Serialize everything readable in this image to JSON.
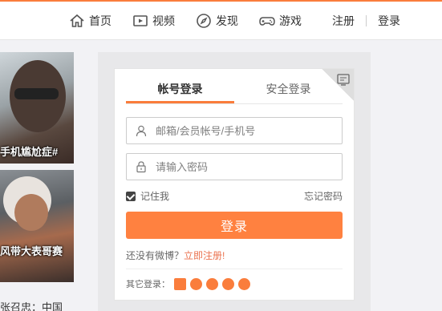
{
  "nav": {
    "items": [
      {
        "label": "首页",
        "icon": "home-icon"
      },
      {
        "label": "视频",
        "icon": "video-icon"
      },
      {
        "label": "发现",
        "icon": "compass-icon"
      },
      {
        "label": "游戏",
        "icon": "gamepad-icon"
      }
    ],
    "register": "注册",
    "login": "登录"
  },
  "feed": {
    "items": [
      {
        "overlay": "手机尴尬症#"
      },
      {
        "overlay": "风带大表哥赛"
      }
    ],
    "caption": "张召忠：中国"
  },
  "login": {
    "tabs": [
      {
        "label": "帐号登录",
        "active": true
      },
      {
        "label": "安全登录",
        "active": false
      }
    ],
    "username_placeholder": "邮箱/会员帐号/手机号",
    "password_placeholder": "请输入密码",
    "remember_label": "记住我",
    "remember_checked": true,
    "forgot_label": "忘记密码",
    "submit_label": "登录",
    "no_account_text": "还没有微博？",
    "register_link": "立即注册!",
    "other_login_label": "其它登录：",
    "other_login_icons": [
      "taobao-icon",
      "qq-icon",
      "tianyi-icon",
      "unicom-icon",
      "360-icon"
    ]
  },
  "colors": {
    "accent": "#fa7d3c",
    "button": "#ff8140",
    "link": "#eb7350"
  }
}
